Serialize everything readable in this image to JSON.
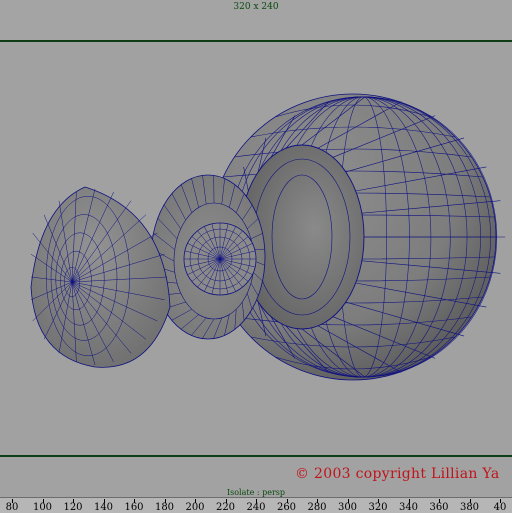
{
  "viewport": {
    "resolution_label": "320 x 240",
    "camera_label": "Isolate : persp",
    "copyright": "© 2003 copyright Lillian Ya"
  },
  "colors": {
    "background": "#a2a2a2",
    "wireframe": "#0d1080",
    "gate_line": "#0f3d16",
    "copyright": "#c0141b"
  },
  "timeline": {
    "labels": [
      "80",
      "100",
      "120",
      "140",
      "160",
      "180",
      "200",
      "220",
      "240",
      "260",
      "280",
      "300",
      "320",
      "340",
      "360",
      "380",
      "40"
    ]
  }
}
